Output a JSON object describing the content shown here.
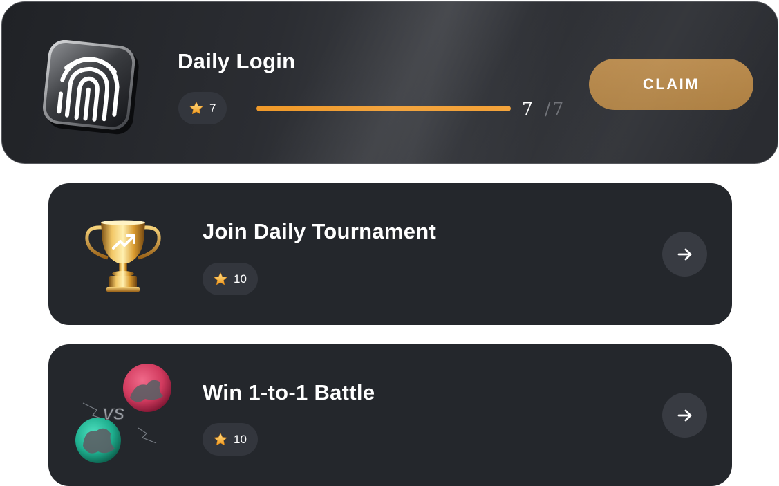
{
  "quests": {
    "daily_login": {
      "title": "Daily Login",
      "reward": "7",
      "progress_current": "7",
      "progress_total": "/7",
      "progress_fraction": 1.0,
      "claim_label": "CLAIM",
      "icon": "fingerprint-icon"
    },
    "tournament": {
      "title": "Join Daily Tournament",
      "reward": "10",
      "icon": "trophy-icon",
      "action_icon": "arrow-right-icon"
    },
    "battle": {
      "title": "Win 1-to-1 Battle",
      "reward": "10",
      "icon": "versus-battle-icon",
      "action_icon": "arrow-right-icon"
    }
  },
  "colors": {
    "card_bg": "#24272c",
    "pill_bg": "#33363d",
    "accent_orange": "#f09a2a",
    "claim_gold": "#b38545",
    "muted_text": "#6d6f75"
  }
}
